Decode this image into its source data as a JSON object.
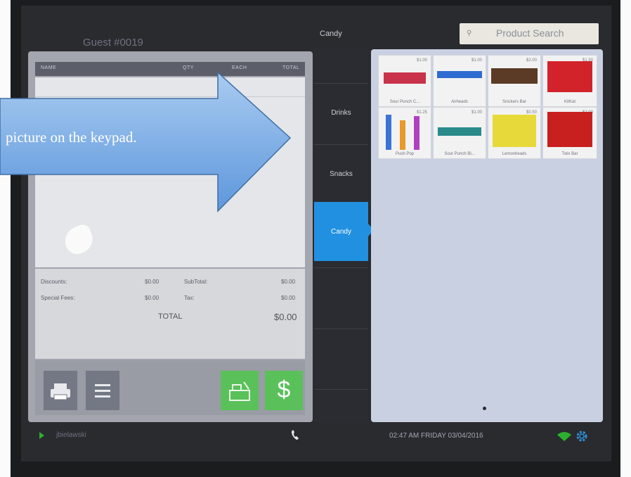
{
  "header": {
    "guest_label": "Guest #0019",
    "category_title": "Candy",
    "search_placeholder": "Product Search",
    "search_icon": "search-icon"
  },
  "cart": {
    "columns": [
      "NAME",
      "QTY",
      "EACH",
      "TOTAL"
    ],
    "discounts_label": "Discounts:",
    "discounts_value": "$0.00",
    "subtotal_label": "SubTotal:",
    "subtotal_value": "$0.00",
    "special_fees_label": "Special Fees:",
    "special_fees_value": "$0.00",
    "tax_label": "Tax:",
    "tax_value": "$0.00",
    "total_label": "TOTAL",
    "total_value": "$0.00"
  },
  "actions": {
    "print_icon": "printer-icon",
    "menu_icon": "menu-icon",
    "register_icon": "cash-register-icon",
    "pay_symbol": "$"
  },
  "categories": [
    {
      "label": ""
    },
    {
      "label": "Drinks"
    },
    {
      "label": "Snacks"
    },
    {
      "label": "Candy",
      "selected": true
    },
    {
      "label": ""
    },
    {
      "label": ""
    }
  ],
  "products": [
    {
      "name": "Sour Punch C...",
      "price": "$1.00",
      "color": "#c8324a"
    },
    {
      "name": "Airheads",
      "price": "$1.00",
      "color": "#2f6bd0"
    },
    {
      "name": "Snickers Bar",
      "price": "$2.00",
      "color": "#5b3b25"
    },
    {
      "name": "KitKat",
      "price": "$1.50",
      "color": "#d2232a"
    },
    {
      "name": "Push Pop",
      "price": "$1.25",
      "color": "#3a74d6"
    },
    {
      "name": "Sour Punch Bl...",
      "price": "$1.00",
      "color": "#2a8a8a"
    },
    {
      "name": "Lemonheads",
      "price": "$0.50",
      "color": "#e8d93a"
    },
    {
      "name": "Twix Bar",
      "price": "$2.00",
      "color": "#c8201f"
    }
  ],
  "status_bar": {
    "user": "jbielawski",
    "datetime": "02:47 AM FRIDAY 03/04/2016",
    "phone_icon": "phone-icon",
    "wifi_icon": "wifi-icon",
    "settings_icon": "gear-icon"
  },
  "annotation": {
    "text": "picture on the keypad."
  },
  "colors": {
    "accent_blue": "#2190e0",
    "green_button": "#5ac05a",
    "wifi_green": "#2db02d"
  }
}
